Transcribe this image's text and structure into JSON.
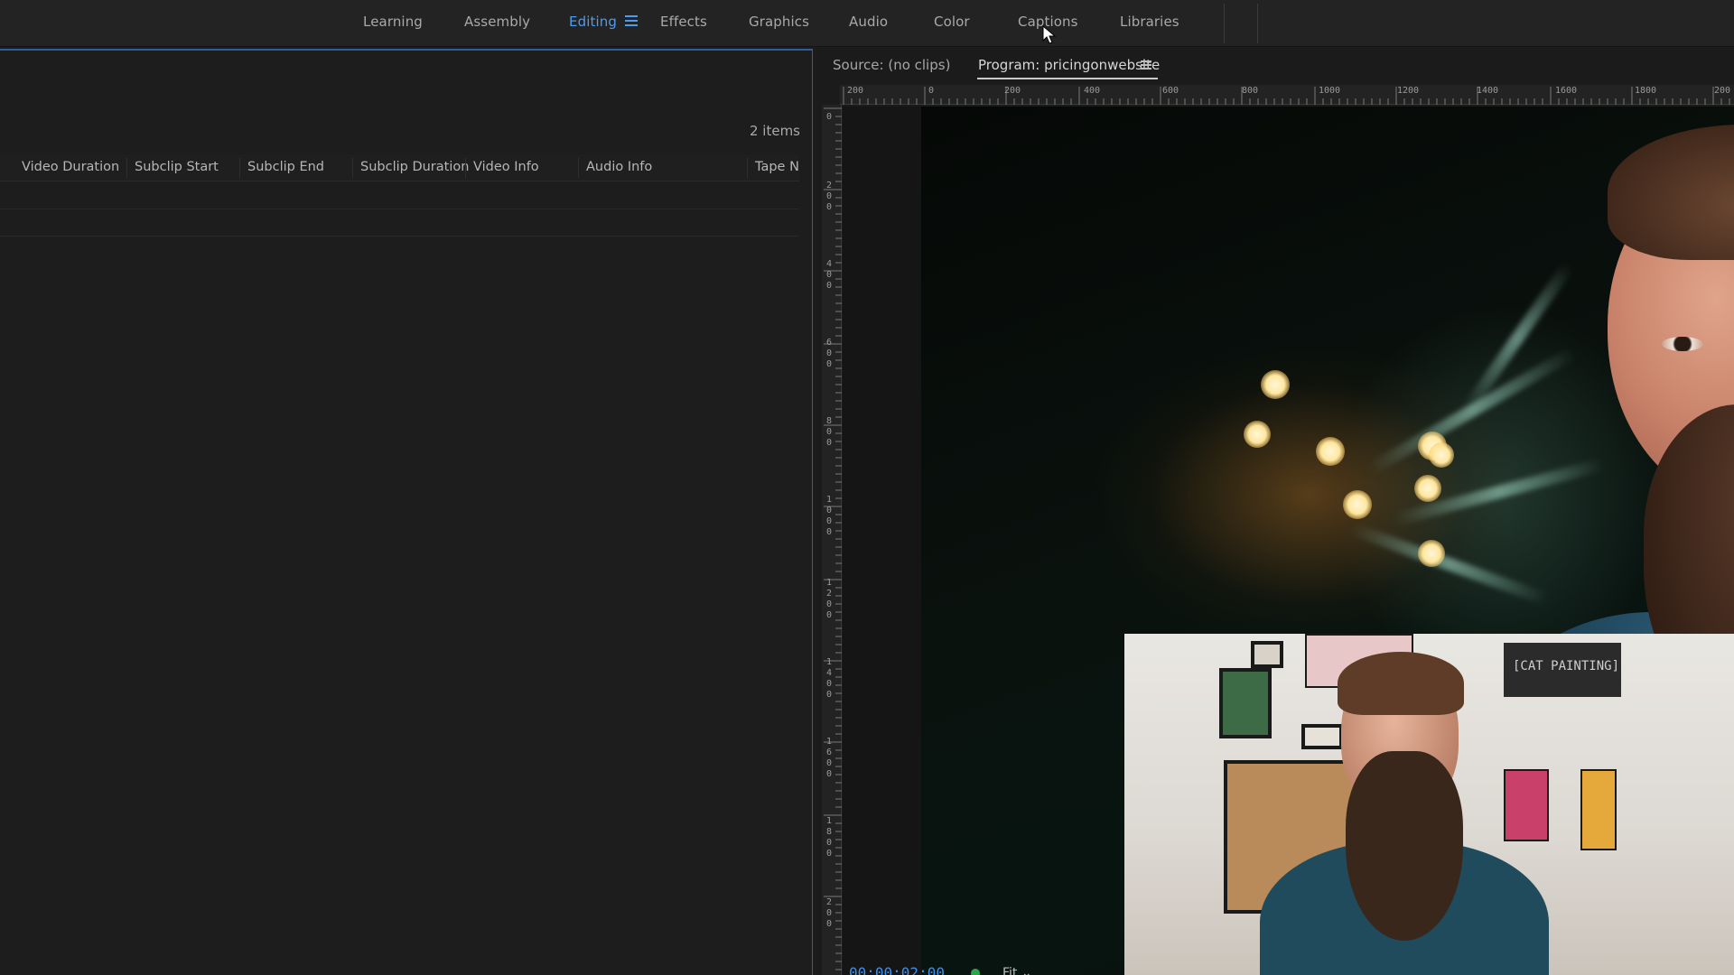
{
  "workspace": {
    "tabs": [
      {
        "label": "Learning",
        "active": false
      },
      {
        "label": "Assembly",
        "active": false
      },
      {
        "label": "Editing",
        "active": true
      },
      {
        "label": "Effects",
        "active": false
      },
      {
        "label": "Graphics",
        "active": false
      },
      {
        "label": "Audio",
        "active": false
      },
      {
        "label": "Color",
        "active": false
      },
      {
        "label": "Captions",
        "active": false
      },
      {
        "label": "Libraries",
        "active": false
      }
    ],
    "menu_icon": "hamburger-menu-icon"
  },
  "project": {
    "items_count": "2 items",
    "columns": [
      "Video Duration",
      "Subclip Start",
      "Subclip End",
      "Subclip Duration",
      "Video Info",
      "Audio Info",
      "Tape Na"
    ],
    "rows": [
      "",
      ""
    ]
  },
  "monitor": {
    "source_tab": "Source: (no clips)",
    "program_tab": "Program: pricingonwebsite",
    "ruler_top": [
      "200",
      "0",
      "200",
      "400",
      "600",
      "800",
      "1000",
      "1200",
      "1400",
      "1600",
      "1800",
      "200"
    ],
    "ruler_left": [
      "0",
      "200",
      "400",
      "600",
      "800",
      "1000",
      "1200",
      "1400",
      "1600",
      "1800",
      "200"
    ],
    "timecode": "00:00:02:00",
    "fit": "Fit",
    "pip_sign_text": "[CAT PAINTING]"
  },
  "colors": {
    "accent": "#4b9cf0",
    "panel_border": "#2d5f9a",
    "status_green": "#2ea44a"
  }
}
